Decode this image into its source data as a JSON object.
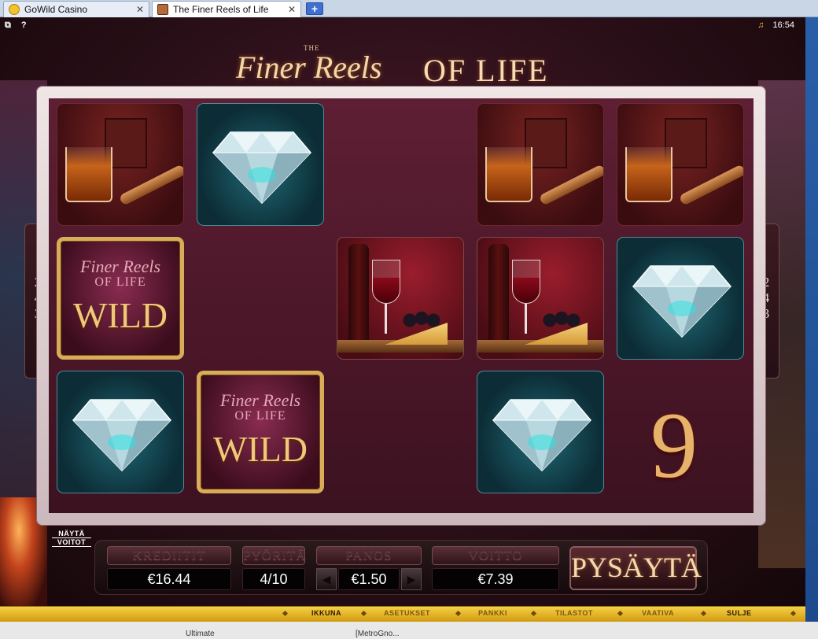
{
  "browser": {
    "tabs": [
      {
        "label": "GoWild Casino",
        "close": "✕"
      },
      {
        "label": "The Finer Reels of Life",
        "close": "✕"
      }
    ],
    "new_tab": "+"
  },
  "status": {
    "help": "?",
    "time": "16:54"
  },
  "logo": {
    "the": "THE",
    "script": "Finer Reels",
    "caps": "OF LIFE"
  },
  "ways": {
    "left": [
      "2",
      "4",
      "3"
    ],
    "right": [
      "2",
      "4",
      "3"
    ]
  },
  "reels": [
    {
      "row": 0,
      "col": 0,
      "symbol": "whisky"
    },
    {
      "row": 0,
      "col": 1,
      "symbol": "diamond"
    },
    {
      "row": 0,
      "col": 3,
      "symbol": "whisky"
    },
    {
      "row": 0,
      "col": 4,
      "symbol": "whisky"
    },
    {
      "row": 1,
      "col": 0,
      "symbol": "wild"
    },
    {
      "row": 1,
      "col": 2,
      "symbol": "wine"
    },
    {
      "row": 1,
      "col": 3,
      "symbol": "wine"
    },
    {
      "row": 1,
      "col": 4,
      "symbol": "diamond"
    },
    {
      "row": 2,
      "col": 0,
      "symbol": "diamond"
    },
    {
      "row": 2,
      "col": 1,
      "symbol": "wild"
    },
    {
      "row": 2,
      "col": 3,
      "symbol": "diamond"
    }
  ],
  "wild": {
    "l1": "Finer Reels",
    "l2": "OF LIFE",
    "l3": "WILD"
  },
  "symbol_nine": "9",
  "controls": {
    "nayta": {
      "l1": "NÄYTÄ",
      "l2": "VOITOT"
    },
    "krediitit": {
      "label": "KREDIITIT",
      "value": "€16.44"
    },
    "pyorita": {
      "label": "PYÖRITÄ",
      "value": "4/10"
    },
    "panos": {
      "label": "PANOS",
      "value": "€1.50",
      "dec": "◀",
      "inc": "▶"
    },
    "voitto": {
      "label": "VOITTO",
      "value": "€7.39"
    },
    "spin": "PYSÄYTÄ"
  },
  "menu": [
    "IKKUNA",
    "ASETUKSET",
    "PANKKI",
    "TILASTOT",
    "VAATIVA",
    "SULJE"
  ],
  "menu_active": [
    "IKKUNA",
    "SULJE"
  ],
  "desktop": [
    "Ultimate",
    "[MetroGno..."
  ],
  "colors": {
    "accent_gold": "#d9ad58",
    "menu_yellow": "#f6d046",
    "reel_bg": "#4a1628"
  }
}
